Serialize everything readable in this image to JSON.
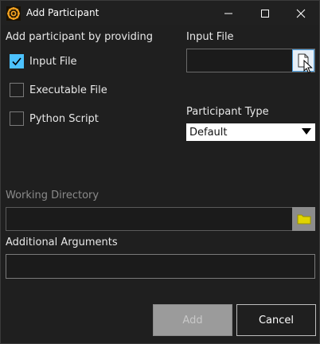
{
  "window": {
    "title": "Add Participant",
    "app_icon": "gear-logo-icon",
    "controls": [
      "minimize-icon",
      "maximize-icon",
      "close-icon"
    ]
  },
  "provide_group": {
    "label": "Add participant by providing",
    "options": [
      {
        "label": "Input File",
        "checked": true
      },
      {
        "label": "Executable File",
        "checked": false
      },
      {
        "label": "Python Script",
        "checked": false
      }
    ]
  },
  "input_file": {
    "label": "Input File",
    "value": "",
    "browse_icon": "document-icon"
  },
  "participant_type": {
    "label": "Participant Type",
    "selected": "Default"
  },
  "working_directory": {
    "label": "Working Directory",
    "value": "",
    "enabled": false,
    "browse_icon": "folder-icon"
  },
  "additional_arguments": {
    "label": "Additional Arguments",
    "value": ""
  },
  "buttons": {
    "add": "Add",
    "add_enabled": false,
    "cancel": "Cancel"
  },
  "colors": {
    "background": "#1f1f1f",
    "accent": "#4cc2ff",
    "folder": "#e0d400"
  }
}
